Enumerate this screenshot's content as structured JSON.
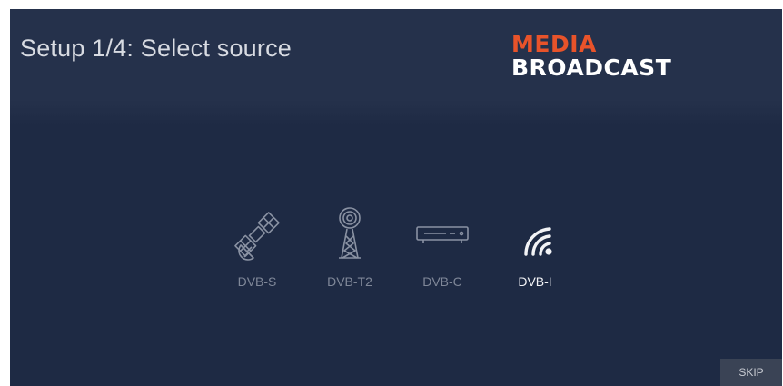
{
  "header": {
    "title": "Setup 1/4: Select source",
    "logo_line1": "MEDIA",
    "logo_line2": "BROADCAST"
  },
  "sources": [
    {
      "label": "DVB-S",
      "icon": "satellite-icon",
      "selected": false
    },
    {
      "label": "DVB-T2",
      "icon": "antenna-tower-icon",
      "selected": false
    },
    {
      "label": "DVB-C",
      "icon": "cable-box-icon",
      "selected": false
    },
    {
      "label": "DVB-I",
      "icon": "wifi-icon",
      "selected": true
    }
  ],
  "skip_label": "SKIP",
  "colors": {
    "background": "#1e2a44",
    "header": "#25314b",
    "brand_accent": "#e8532a",
    "inactive_text": "#7f8798",
    "active_text": "#f2f3f6"
  }
}
